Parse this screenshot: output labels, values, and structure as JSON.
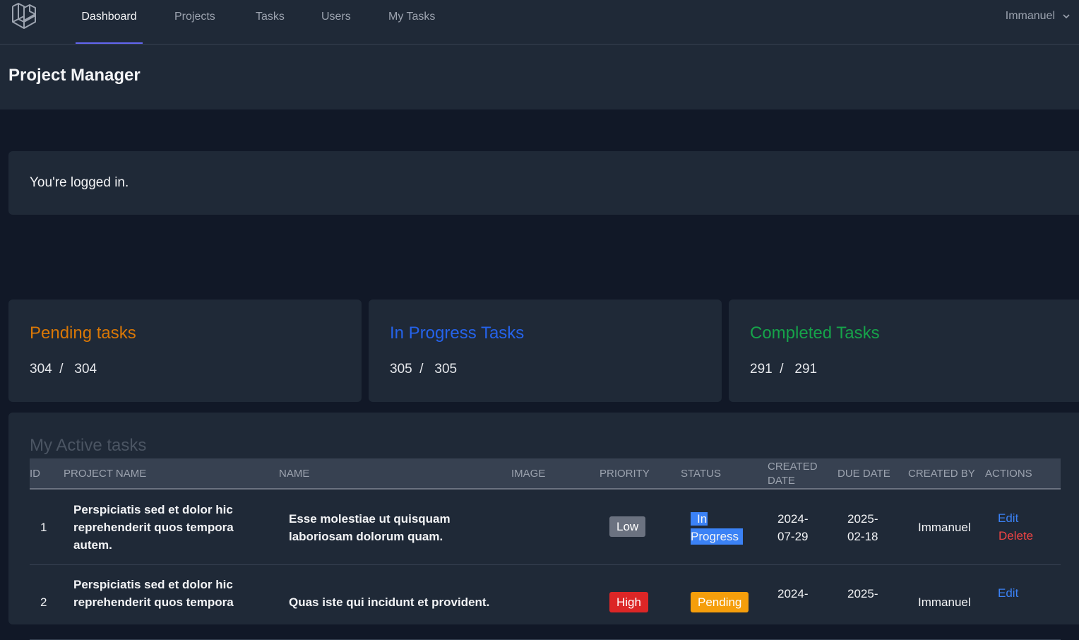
{
  "nav": {
    "links": [
      "Dashboard",
      "Projects",
      "Tasks",
      "Users",
      "My Tasks"
    ],
    "user": "Immanuel",
    "accent": "#6366f1"
  },
  "header": {
    "title": "Project Manager"
  },
  "welcome": {
    "message": "You're logged in."
  },
  "stats": [
    {
      "title": "Pending tasks",
      "current": "304",
      "total": "304",
      "color": "#d97706"
    },
    {
      "title": "In Progress Tasks",
      "current": "305",
      "total": "305",
      "color": "#2563eb"
    },
    {
      "title": "Completed Tasks",
      "current": "291",
      "total": "291",
      "color": "#16a34a"
    }
  ],
  "active_tasks": {
    "title": "My Active tasks",
    "columns": [
      "ID",
      "Project Name",
      "Name",
      "Image",
      "Priority",
      "Status",
      "Created Date",
      "Due Date",
      "Created By",
      "Actions"
    ],
    "created_date_lines": [
      "Created",
      "Date"
    ],
    "rows": [
      {
        "id": "1",
        "project": [
          "Perspiciatis sed et dolor hic",
          "reprehenderit quos tempora",
          "autem."
        ],
        "name": [
          "Esse molestiae ut quisquam",
          "laboriosam dolorum quam."
        ],
        "priority": "Low",
        "priority_color": "#6b7280",
        "status": [
          "In",
          "Progress"
        ],
        "status_color": "#3b82f6",
        "created": [
          "2024-",
          "07-29"
        ],
        "due": [
          "2025-",
          "02-18"
        ],
        "created_by": "Immanuel",
        "edit": "Edit",
        "delete": "Delete"
      },
      {
        "id": "2",
        "project": [
          "Perspiciatis sed et dolor hic",
          "reprehenderit quos tempora"
        ],
        "name": [
          "Quas iste qui incidunt et provident."
        ],
        "priority": "High",
        "priority_color": "#dc2626",
        "status": [
          "Pending"
        ],
        "status_color": "#f59e0b",
        "created": [
          "2024-"
        ],
        "due": [
          "2025-"
        ],
        "created_by": "Immanuel",
        "edit": "Edit"
      }
    ]
  }
}
